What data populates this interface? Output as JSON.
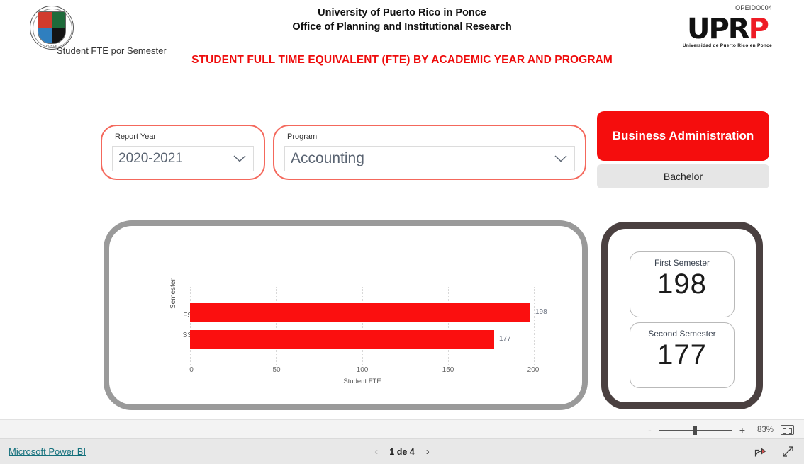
{
  "header": {
    "org_line1": "University of Puerto Rico in Ponce",
    "org_line2": "Office of Planning and Institutional Research",
    "report_code": "OPEIDO004",
    "logo_text_black": "UPR",
    "logo_text_red": "P",
    "logo_subtitle": "Universidad de Puerto Rico en Ponce",
    "seal_caption": "PONCE",
    "main_title": "STUDENT FULL TIME EQUIVALENT (FTE) BY ACADEMIC YEAR AND PROGRAM"
  },
  "filters": {
    "report_year": {
      "label": "Report Year",
      "value": "2020-2021"
    },
    "program": {
      "label": "Program",
      "value": "Accounting"
    }
  },
  "program_badge": {
    "name": "Business Administration",
    "level": "Bachelor"
  },
  "kpis": [
    {
      "caption": "First Semester",
      "value": "198"
    },
    {
      "caption": "Second Semester",
      "value": "177"
    }
  ],
  "chart_data": {
    "type": "bar",
    "orientation": "horizontal",
    "title": "Student FTE por Semester",
    "categories": [
      "FS",
      "SS"
    ],
    "values": [
      198,
      177
    ],
    "data_labels": [
      "198",
      "177"
    ],
    "xlabel": "Student FTE",
    "ylabel": "Semester",
    "xlim": [
      0,
      200
    ],
    "xticks": [
      "0",
      "50",
      "100",
      "150",
      "200"
    ],
    "bar_color": "#fb0f0f",
    "grid": true,
    "legend": "none"
  },
  "statusbar": {
    "zoom_minus": "-",
    "zoom_plus": "+",
    "zoom_level": "83%",
    "fit_icon": "fit-to-page-icon"
  },
  "footer": {
    "powerbi_link": "Microsoft Power BI",
    "page_indicator": "1 de 4",
    "prev_icon": "chevron-left-icon",
    "next_icon": "chevron-right-icon",
    "share_icon": "share-icon",
    "fullscreen_icon": "fullscreen-icon"
  }
}
